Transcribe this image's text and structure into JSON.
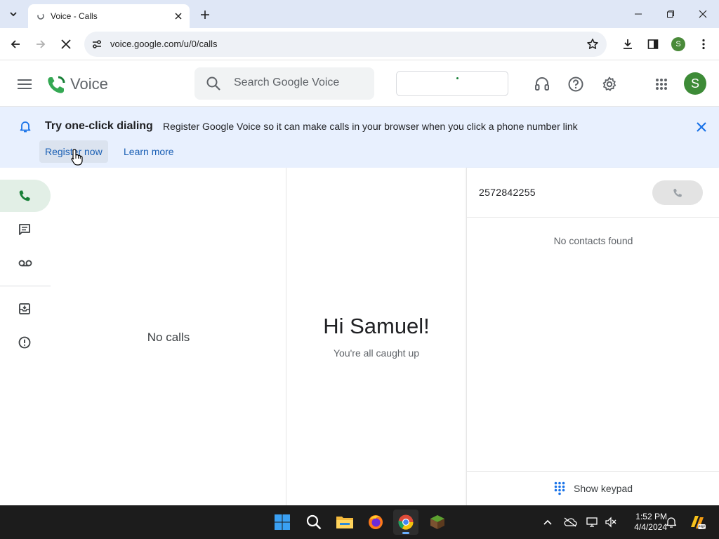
{
  "browser": {
    "tab_title": "Voice - Calls",
    "url": "voice.google.com/u/0/calls",
    "profile_initial": "S"
  },
  "header": {
    "app_name": "Voice",
    "search_placeholder": "Search Google Voice",
    "avatar_initial": "S"
  },
  "banner": {
    "title": "Try one-click dialing",
    "description": "Register Google Voice so it can make calls in your browser when you click a phone number link",
    "register_label": "Register now",
    "learn_label": "Learn more"
  },
  "nav": {
    "items": [
      {
        "name": "calls",
        "icon": "phone-icon",
        "active": true
      },
      {
        "name": "messages",
        "icon": "message-icon",
        "active": false
      },
      {
        "name": "voicemail",
        "icon": "voicemail-icon",
        "active": false
      },
      {
        "name": "archive",
        "icon": "archive-icon",
        "active": false
      },
      {
        "name": "spam",
        "icon": "spam-icon",
        "active": false
      }
    ]
  },
  "calls": {
    "empty_text": "No calls"
  },
  "detail": {
    "greeting": "Hi Samuel!",
    "subtext": "You're all caught up"
  },
  "dialer": {
    "number": "2572842255",
    "no_contacts": "No contacts found",
    "keypad_label": "Show keypad"
  },
  "taskbar": {
    "time": "1:52 PM",
    "date": "4/4/2024",
    "apps": [
      "start-icon",
      "search-icon",
      "file-explorer-icon",
      "firefox-icon",
      "chrome-icon",
      "minecraft-icon"
    ]
  },
  "colors": {
    "accent_green": "#188038",
    "banner_bg": "#e8f0fe",
    "link_blue": "#1a5fb4"
  }
}
